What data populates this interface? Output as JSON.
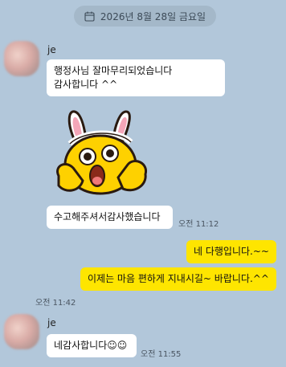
{
  "date_divider": {
    "label": "2026년 8월 28일 금요일"
  },
  "messages": [
    {
      "sender": "je",
      "text": "행정사님 잘마무리되었습니다 감사합니다 ^^"
    },
    {
      "text": "수고해주셔서감사했습니다",
      "time": "오전 11:12"
    },
    {
      "text": "네 다행입니다.~~"
    },
    {
      "text": "이제는 마음 편하게 지내시길~ 바랍니다.^^",
      "time": "오전 11:42"
    },
    {
      "sender": "je",
      "text": "네감사합니다☺☺",
      "time": "오전 11:55"
    }
  ],
  "sticker": {
    "name": "bunny-ears-character-sticker"
  },
  "colors": {
    "background": "#b2c7da",
    "incoming_bubble": "#ffffff",
    "outgoing_bubble": "#fee500"
  }
}
